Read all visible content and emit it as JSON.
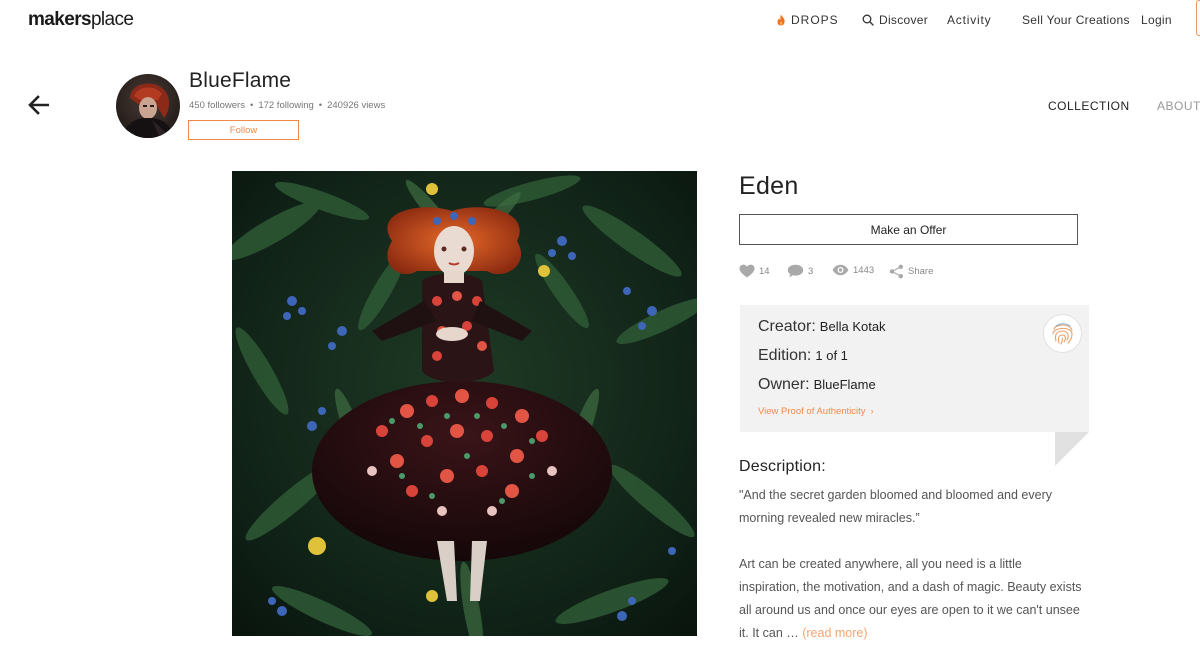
{
  "nav": {
    "logo_bold": "makers",
    "logo_rest": "place",
    "drops": "DROPS",
    "discover": "Discover",
    "activity": "Activity",
    "sell": "Sell Your Creations",
    "login": "Login"
  },
  "profile": {
    "name": "BlueFlame",
    "followers": "450 followers",
    "following": "172 following",
    "views": "240926 views",
    "follow_label": "Follow"
  },
  "tabs": {
    "collection": "COLLECTION",
    "about": "ABOUT"
  },
  "artwork": {
    "title": "Eden",
    "offer_label": "Make an Offer",
    "likes": "14",
    "comments": "3",
    "views": "1443",
    "share": "Share"
  },
  "details": {
    "creator_label": "Creator:",
    "creator": "Bella Kotak",
    "edition_label": "Edition:",
    "edition": "1 of 1",
    "owner_label": "Owner:",
    "owner": "BlueFlame",
    "proof_link": "View Proof of Authenticity"
  },
  "description": {
    "heading": "Description:",
    "quote": "\"And the secret garden bloomed and bloomed and every morning revealed new miracles.”",
    "body": "Art can be created anywhere, all you need is a little inspiration, the motivation, and a dash of magic. Beauty exists all around us and once our eyes are open to it we can't unsee it. It can …",
    "read_more": "(read more)"
  },
  "colors": {
    "accent": "#f08a4b",
    "drops_flame": "#f2711c"
  }
}
